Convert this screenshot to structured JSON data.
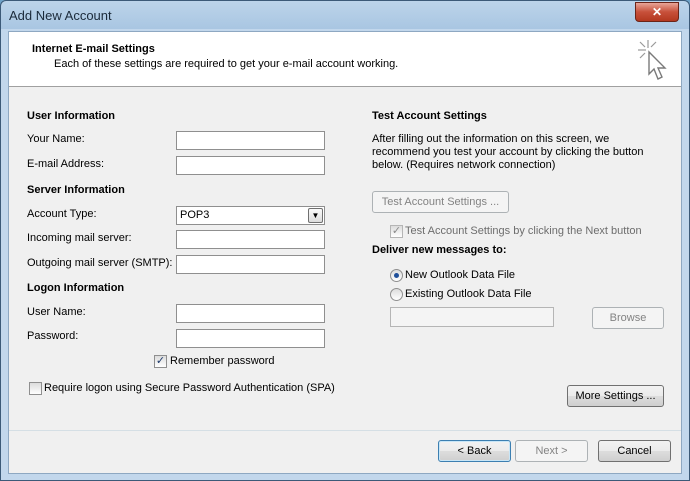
{
  "window": {
    "title": "Add New Account",
    "close_glyph": "✕"
  },
  "header": {
    "title": "Internet E-mail Settings",
    "subtitle": "Each of these settings are required to get your e-mail account working.",
    "icon": "cursor-sparkle-icon"
  },
  "user_info": {
    "heading": "User Information",
    "your_name_label": "Your Name:",
    "your_name_value": "",
    "email_label": "E-mail Address:",
    "email_value": ""
  },
  "server_info": {
    "heading": "Server Information",
    "account_type_label": "Account Type:",
    "account_type_value": "POP3",
    "incoming_label": "Incoming mail server:",
    "incoming_value": "",
    "outgoing_label": "Outgoing mail server (SMTP):",
    "outgoing_value": ""
  },
  "logon_info": {
    "heading": "Logon Information",
    "username_label": "User Name:",
    "username_value": "",
    "password_label": "Password:",
    "password_value": "",
    "remember_label": "Remember password",
    "remember_checked": true,
    "spa_label": "Require logon using Secure Password Authentication (SPA)",
    "spa_checked": false
  },
  "test_settings": {
    "heading": "Test Account Settings",
    "description_1": "After filling out the information on this screen, we",
    "description_2": "recommend you test your account by clicking the button",
    "description_3": "below. (Requires network connection)",
    "test_button": "Test Account Settings ...",
    "test_next_label": "Test Account Settings by clicking the Next button",
    "test_next_checked": true
  },
  "deliver": {
    "heading": "Deliver new messages to:",
    "new_file_label": "New Outlook Data File",
    "existing_file_label": "Existing Outlook Data File",
    "selected": "new",
    "existing_path_value": "",
    "browse_button": "Browse"
  },
  "buttons": {
    "more_settings": "More Settings ...",
    "back": "< Back",
    "next": "Next >",
    "cancel": "Cancel"
  },
  "check_glyph": "✓"
}
